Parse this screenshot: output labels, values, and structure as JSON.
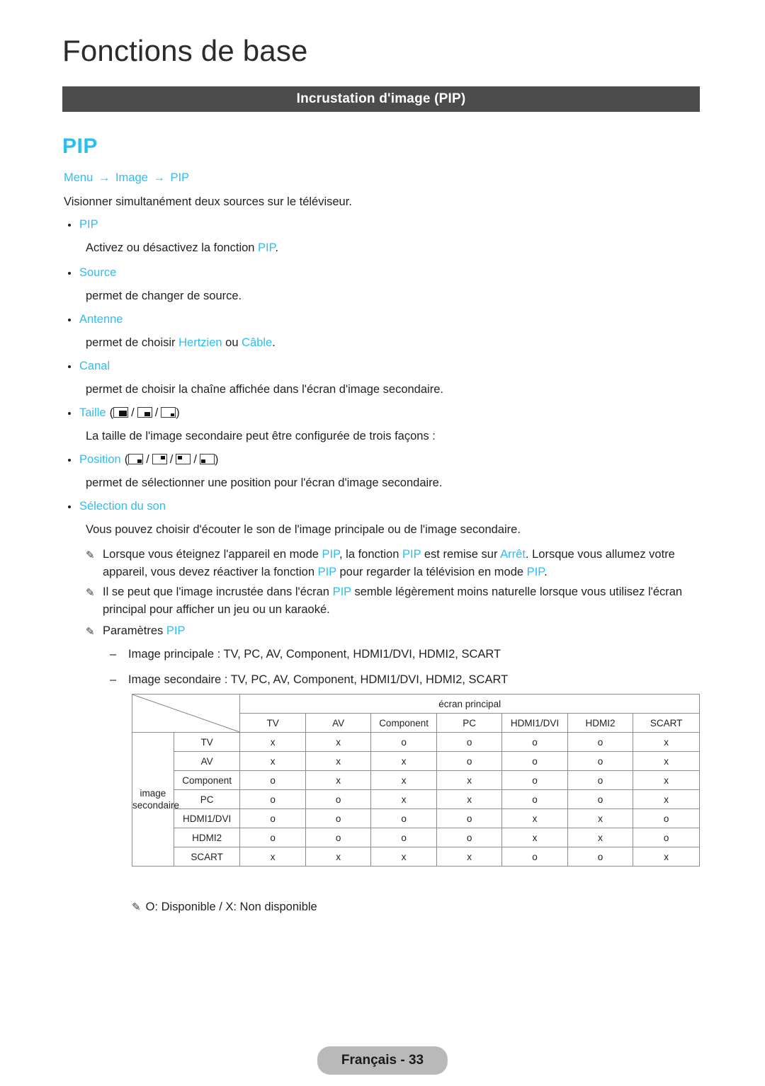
{
  "header": {
    "chapter_title": "Fonctions de base",
    "section_banner": "Incrustation d'image (PIP)",
    "feature_heading": "PIP"
  },
  "breadcrumb": {
    "item1": "Menu",
    "arrow1": "→",
    "item2": "Image",
    "arrow2": "→",
    "item3": "PIP"
  },
  "intro": "Visionner simultanément deux sources sur le téléviseur.",
  "bullets": [
    {
      "label": "PIP",
      "description_pre": "Activez ou désactivez la fonction ",
      "description_accent": "PIP",
      "description_post": "."
    },
    {
      "label": "Source",
      "description_pre": "permet de changer de source.",
      "description_accent": "",
      "description_post": ""
    },
    {
      "label": "Antenne",
      "description_pre": "permet de choisir ",
      "description_accent": "Hertzien",
      "description_mid": " ou ",
      "description_accent2": "Câble",
      "description_post": "."
    },
    {
      "label": "Canal",
      "description_pre": "permet de choisir la chaîne affichée dans l'écran d'image secondaire.",
      "description_accent": "",
      "description_post": ""
    },
    {
      "label": "Taille",
      "icons": [
        "size-large-icon",
        "size-medium-icon",
        "size-small-icon"
      ],
      "description_pre": "La taille de l'image secondaire peut être configurée de trois façons :",
      "description_accent": "",
      "description_post": ""
    },
    {
      "label": "Position",
      "icons": [
        "position-bottom-right-icon",
        "position-top-right-icon",
        "position-top-left-icon",
        "position-bottom-left-icon"
      ],
      "description_pre": "permet de sélectionner une position pour l'écran d'image secondaire.",
      "description_accent": "",
      "description_post": ""
    },
    {
      "label": "Sélection du son",
      "description_pre": "Vous pouvez choisir d'écouter le son de l'image principale ou de l'image secondaire.",
      "description_accent": "",
      "description_post": ""
    }
  ],
  "notes": {
    "note1": {
      "p1": "Lorsque vous éteignez l'appareil en mode ",
      "a1": "PIP",
      "p2": ", la fonction ",
      "a2": "PIP",
      "p3": " est remise sur ",
      "a3": "Arrêt",
      "p4": ". Lorsque vous allumez votre appareil, vous devez réactiver la fonction ",
      "a4": "PIP",
      "p5": " pour regarder la télévision en mode ",
      "a5": "PIP",
      "p6": "."
    },
    "note2": {
      "p1": "Il se peut que l'image incrustée dans l'écran ",
      "a1": "PIP",
      "p2": " semble légèrement moins naturelle lorsque vous utilisez l'écran principal pour afficher un jeu ou un karaoké."
    },
    "note3": {
      "p1": "Paramètres ",
      "a1": "PIP"
    },
    "dash1": "Image principale : TV, PC, AV, Component, HDMI1/DVI, HDMI2, SCART",
    "dash2": "Image secondaire : TV, PC, AV, Component, HDMI1/DVI, HDMI2, SCART",
    "pen_icon": "✎",
    "dash_mark": "–"
  },
  "table": {
    "main_header": "écran principal",
    "side_header_line1": "image",
    "side_header_line2": "secondaire",
    "columns": [
      "TV",
      "AV",
      "Component",
      "PC",
      "HDMI1/DVI",
      "HDMI2",
      "SCART"
    ],
    "rows": [
      {
        "label": "TV",
        "values": [
          "x",
          "x",
          "o",
          "o",
          "o",
          "o",
          "x"
        ]
      },
      {
        "label": "AV",
        "values": [
          "x",
          "x",
          "x",
          "o",
          "o",
          "o",
          "x"
        ]
      },
      {
        "label": "Component",
        "values": [
          "o",
          "x",
          "x",
          "x",
          "o",
          "o",
          "x"
        ]
      },
      {
        "label": "PC",
        "values": [
          "o",
          "o",
          "x",
          "x",
          "o",
          "o",
          "x"
        ]
      },
      {
        "label": "HDMI1/DVI",
        "values": [
          "o",
          "o",
          "o",
          "o",
          "x",
          "x",
          "o"
        ]
      },
      {
        "label": "HDMI2",
        "values": [
          "o",
          "o",
          "o",
          "o",
          "x",
          "x",
          "o"
        ]
      },
      {
        "label": "SCART",
        "values": [
          "x",
          "x",
          "x",
          "x",
          "o",
          "o",
          "x"
        ]
      }
    ]
  },
  "legend": "O: Disponible / X: Non disponible",
  "footer": {
    "page_label": "Français - 33"
  },
  "colors": {
    "accent": "#2bbef0",
    "banner_bg": "#4c4c4c",
    "table_header_bg": "#cccccc",
    "footer_pill_bg": "#b9b9b9",
    "text": "#231f20"
  }
}
